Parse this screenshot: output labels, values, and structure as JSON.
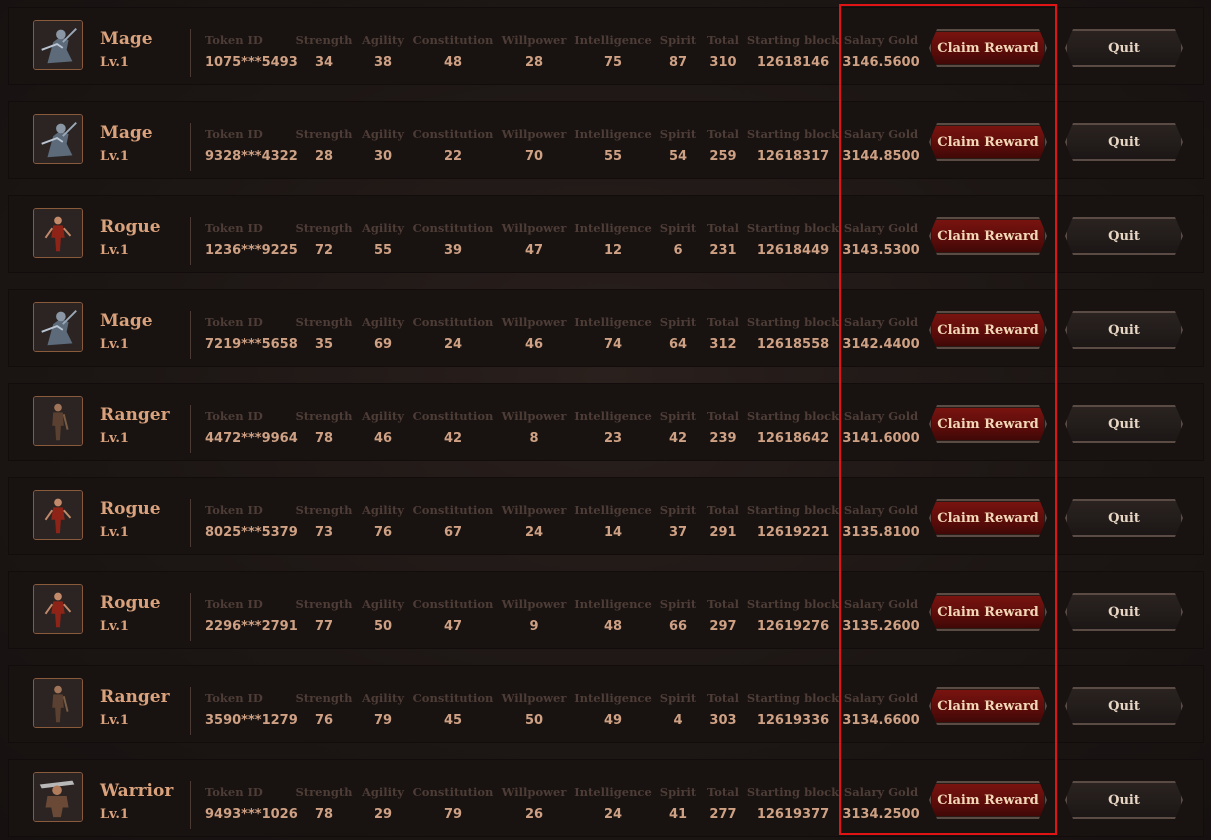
{
  "labels": {
    "token_id": "Token ID",
    "strength": "Strength",
    "agility": "Agility",
    "constitution": "Constitution",
    "willpower": "Willpower",
    "intelligence": "Intelligence",
    "spirit": "Spirit",
    "total": "Total",
    "starting_block": "Starting block",
    "salary_gold": "Salary Gold",
    "claim_button": "Claim Reward",
    "quit_button": "Quit"
  },
  "heroes": [
    {
      "class": "Mage",
      "level": "Lv.1",
      "token_id": "1075***5493",
      "strength": "34",
      "agility": "38",
      "constitution": "48",
      "willpower": "28",
      "intelligence": "75",
      "spirit": "87",
      "total": "310",
      "starting_block": "12618146",
      "salary_gold": "3146.5600",
      "avatar_icon": "mage-portrait-icon"
    },
    {
      "class": "Mage",
      "level": "Lv.1",
      "token_id": "9328***4322",
      "strength": "28",
      "agility": "30",
      "constitution": "22",
      "willpower": "70",
      "intelligence": "55",
      "spirit": "54",
      "total": "259",
      "starting_block": "12618317",
      "salary_gold": "3144.8500",
      "avatar_icon": "mage-portrait-icon"
    },
    {
      "class": "Rogue",
      "level": "Lv.1",
      "token_id": "1236***9225",
      "strength": "72",
      "agility": "55",
      "constitution": "39",
      "willpower": "47",
      "intelligence": "12",
      "spirit": "6",
      "total": "231",
      "starting_block": "12618449",
      "salary_gold": "3143.5300",
      "avatar_icon": "rogue-portrait-icon"
    },
    {
      "class": "Mage",
      "level": "Lv.1",
      "token_id": "7219***5658",
      "strength": "35",
      "agility": "69",
      "constitution": "24",
      "willpower": "46",
      "intelligence": "74",
      "spirit": "64",
      "total": "312",
      "starting_block": "12618558",
      "salary_gold": "3142.4400",
      "avatar_icon": "mage-portrait-icon"
    },
    {
      "class": "Ranger",
      "level": "Lv.1",
      "token_id": "4472***9964",
      "strength": "78",
      "agility": "46",
      "constitution": "42",
      "willpower": "8",
      "intelligence": "23",
      "spirit": "42",
      "total": "239",
      "starting_block": "12618642",
      "salary_gold": "3141.6000",
      "avatar_icon": "ranger-portrait-icon"
    },
    {
      "class": "Rogue",
      "level": "Lv.1",
      "token_id": "8025***5379",
      "strength": "73",
      "agility": "76",
      "constitution": "67",
      "willpower": "24",
      "intelligence": "14",
      "spirit": "37",
      "total": "291",
      "starting_block": "12619221",
      "salary_gold": "3135.8100",
      "avatar_icon": "rogue-portrait-icon"
    },
    {
      "class": "Rogue",
      "level": "Lv.1",
      "token_id": "2296***2791",
      "strength": "77",
      "agility": "50",
      "constitution": "47",
      "willpower": "9",
      "intelligence": "48",
      "spirit": "66",
      "total": "297",
      "starting_block": "12619276",
      "salary_gold": "3135.2600",
      "avatar_icon": "rogue-portrait-icon"
    },
    {
      "class": "Ranger",
      "level": "Lv.1",
      "token_id": "3590***1279",
      "strength": "76",
      "agility": "79",
      "constitution": "45",
      "willpower": "50",
      "intelligence": "49",
      "spirit": "4",
      "total": "303",
      "starting_block": "12619336",
      "salary_gold": "3134.6600",
      "avatar_icon": "ranger-portrait-icon"
    },
    {
      "class": "Warrior",
      "level": "Lv.1",
      "token_id": "9493***1026",
      "strength": "78",
      "agility": "29",
      "constitution": "79",
      "willpower": "26",
      "intelligence": "24",
      "spirit": "41",
      "total": "277",
      "starting_block": "12619377",
      "salary_gold": "3134.2500",
      "avatar_icon": "warrior-portrait-icon"
    }
  ],
  "colors": {
    "class_text": "#d9a27c",
    "label_text": "#4e3d36",
    "value_text": "#cfa184",
    "claim_bg": "#6a0e0b",
    "highlight_border": "#e01414"
  }
}
